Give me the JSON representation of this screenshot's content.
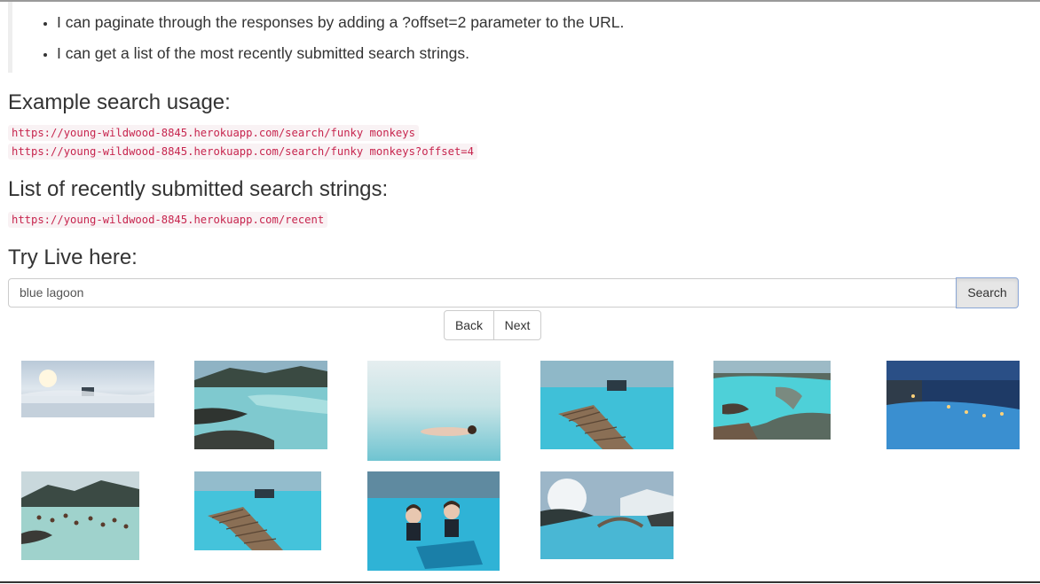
{
  "intro": {
    "bullets": [
      "I can paginate through the responses by adding a ?offset=2 parameter to the URL.",
      "I can get a list of the most recently submitted search strings."
    ]
  },
  "example": {
    "heading": "Example search usage:",
    "urls": [
      "https://young-wildwood-8845.herokuapp.com/search/funky monkeys",
      "https://young-wildwood-8845.herokuapp.com/search/funky monkeys?offset=4"
    ]
  },
  "recent": {
    "heading": "List of recently submitted search strings:",
    "url": "https://young-wildwood-8845.herokuapp.com/recent"
  },
  "live": {
    "heading": "Try Live here:",
    "search_value": "blue lagoon",
    "search_button": "Search",
    "back_button": "Back",
    "next_button": "Next"
  },
  "results": [
    {
      "name": "lagoon-sunset-misty-image"
    },
    {
      "name": "lagoon-lava-field-image"
    },
    {
      "name": "lagoon-woman-floating-image"
    },
    {
      "name": "lagoon-wooden-walkway-image"
    },
    {
      "name": "lagoon-aerial-view-image"
    },
    {
      "name": "lagoon-night-lights-image"
    },
    {
      "name": "lagoon-bathers-image"
    },
    {
      "name": "lagoon-walkway-turquoise-image"
    },
    {
      "name": "lagoon-women-bathing-image"
    },
    {
      "name": "lagoon-bridge-steam-image"
    }
  ]
}
